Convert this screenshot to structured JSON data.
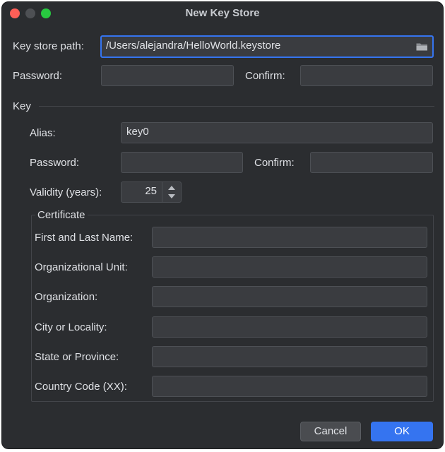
{
  "window": {
    "title": "New Key Store"
  },
  "keystore": {
    "path_label": "Key store path:",
    "path_value": "/Users/alejandra/HelloWorld.keystore",
    "password_label": "Password:",
    "password_value": "",
    "confirm_label": "Confirm:",
    "confirm_value": ""
  },
  "key": {
    "section_label": "Key",
    "alias_label": "Alias:",
    "alias_value": "key0",
    "password_label": "Password:",
    "password_value": "",
    "confirm_label": "Confirm:",
    "confirm_value": "",
    "validity_label": "Validity (years):",
    "validity_value": "25"
  },
  "certificate": {
    "title": "Certificate",
    "fields": [
      {
        "label": "First and Last Name:",
        "value": ""
      },
      {
        "label": "Organizational Unit:",
        "value": ""
      },
      {
        "label": "Organization:",
        "value": ""
      },
      {
        "label": "City or Locality:",
        "value": ""
      },
      {
        "label": "State or Province:",
        "value": ""
      },
      {
        "label": "Country Code (XX):",
        "value": ""
      }
    ]
  },
  "buttons": {
    "cancel": "Cancel",
    "ok": "OK"
  },
  "icons": {
    "browse": "folder-icon"
  },
  "colors": {
    "accent": "#3574f0",
    "background": "#2b2d30",
    "field_bg": "#3a3c40"
  }
}
